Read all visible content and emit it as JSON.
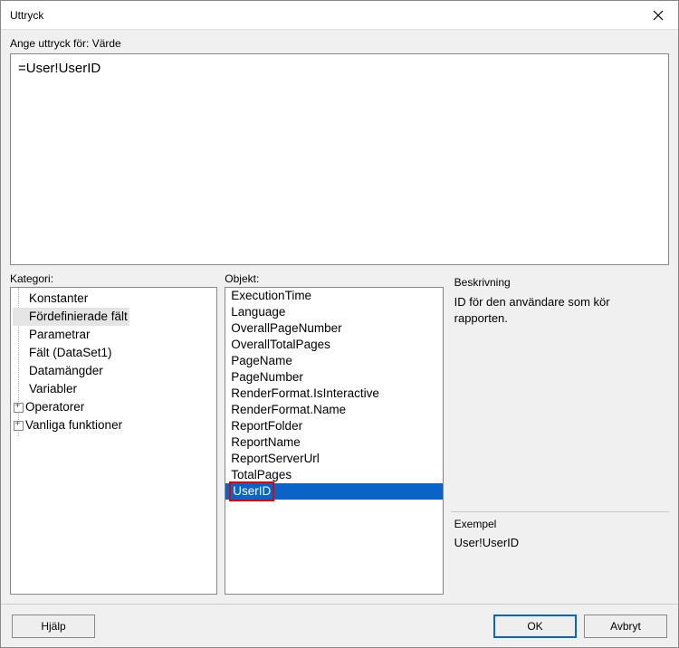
{
  "window": {
    "title": "Uttryck"
  },
  "expression": {
    "label": "Ange uttryck för: Värde",
    "value": "=User!UserID"
  },
  "panels": {
    "category_label": "Kategori:",
    "object_label": "Objekt:"
  },
  "categories": [
    {
      "label": "Konstanter",
      "expander": false
    },
    {
      "label": "Fördefinierade fält",
      "expander": false,
      "selected": true
    },
    {
      "label": "Parametrar",
      "expander": false
    },
    {
      "label": "Fält (DataSet1)",
      "expander": false
    },
    {
      "label": "Datamängder",
      "expander": false
    },
    {
      "label": "Variabler",
      "expander": false
    },
    {
      "label": "Operatorer",
      "expander": true
    },
    {
      "label": "Vanliga funktioner",
      "expander": true
    }
  ],
  "objects": [
    "ExecutionTime",
    "Language",
    "OverallPageNumber",
    "OverallTotalPages",
    "PageName",
    "PageNumber",
    "RenderFormat.IsInteractive",
    "RenderFormat.Name",
    "ReportFolder",
    "ReportName",
    "ReportServerUrl",
    "TotalPages",
    "UserID"
  ],
  "objects_selected": "UserID",
  "description": {
    "label": "Beskrivning",
    "text": "ID för den användare som kör rapporten."
  },
  "example": {
    "label": "Exempel",
    "text": "User!UserID"
  },
  "buttons": {
    "help": "Hjälp",
    "ok": "OK",
    "cancel": "Avbryt"
  }
}
